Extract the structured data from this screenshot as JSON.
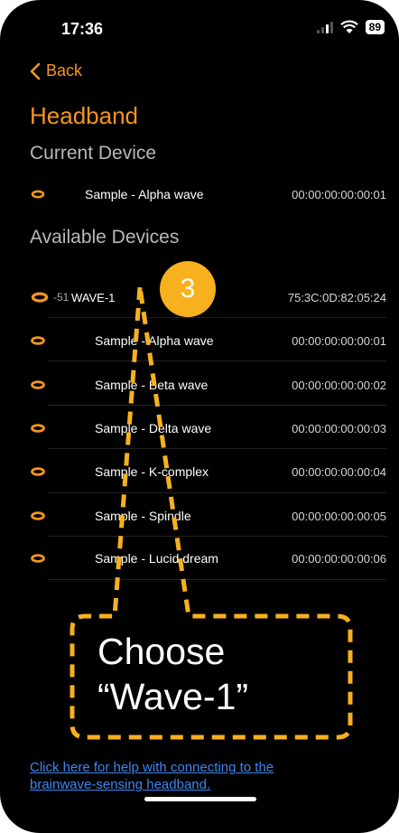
{
  "status": {
    "time": "17:36",
    "battery": "89"
  },
  "nav": {
    "back_label": "Back"
  },
  "page": {
    "title": "Headband"
  },
  "current": {
    "heading": "Current Device",
    "device": {
      "name": "Sample - Alpha wave",
      "address": "00:00:00:00:00:01"
    }
  },
  "available": {
    "heading": "Available Devices",
    "devices": [
      {
        "rssi": "-51",
        "name": "WAVE-1",
        "address": "75:3C:0D:82:05:24"
      },
      {
        "name": "Sample - Alpha wave",
        "address": "00:00:00:00:00:01"
      },
      {
        "name": "Sample - Beta wave",
        "address": "00:00:00:00:00:02"
      },
      {
        "name": "Sample - Delta wave",
        "address": "00:00:00:00:00:03"
      },
      {
        "name": "Sample - K-complex",
        "address": "00:00:00:00:00:04"
      },
      {
        "name": "Sample - Spindle",
        "address": "00:00:00:00:00:05"
      },
      {
        "name": "Sample - Lucid dream",
        "address": "00:00:00:00:00:06"
      }
    ]
  },
  "annotation": {
    "step": "3",
    "line1": "Choose",
    "line2": "“Wave-1”"
  },
  "help": {
    "line1": "Click here for help with connecting to the",
    "line2": "brainwave-sensing headband."
  },
  "colors": {
    "accent": "#f5951f",
    "callout": "#f7b11f",
    "link": "#3d86f0"
  }
}
